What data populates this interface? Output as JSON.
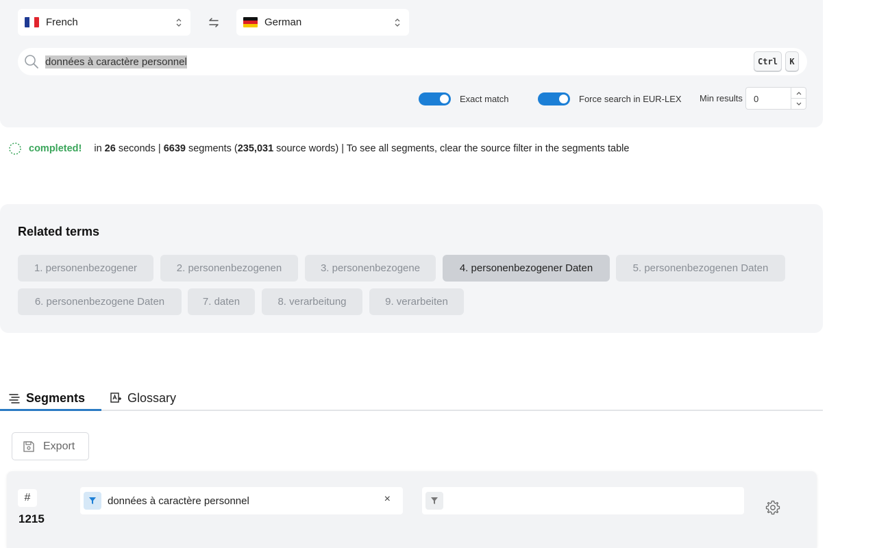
{
  "languages": {
    "source": "French",
    "target": "German",
    "swap_icon": "swap-arrows-icon"
  },
  "search": {
    "query": "données à caractère personnel",
    "shortcut_keys": [
      "Ctrl",
      "K"
    ]
  },
  "options": {
    "exact_match_label": "Exact match",
    "exact_match_on": true,
    "force_search_label": "Force search in EUR-LEX",
    "force_search_on": true,
    "min_results_label": "Min results",
    "min_results_value": "0"
  },
  "status": {
    "state": "completed!",
    "prefix": "in",
    "seconds": "26",
    "seconds_label": "seconds |",
    "segments": "6639",
    "segments_label": "segments (",
    "source_words": "235,031",
    "source_words_label": "source words) | To see all segments, clear the source filter in the segments table"
  },
  "related_terms": {
    "title": "Related terms",
    "items": [
      "1. personenbezogener",
      "2. personenbezogenen",
      "3. personenbezogene",
      "4. personenbezogener Daten",
      "5. personenbezogenen Daten",
      "6. personenbezogene Daten",
      "7. daten",
      "8. verarbeitung",
      "9. verarbeiten"
    ],
    "active_index": 3
  },
  "tabs": {
    "segments": "Segments",
    "glossary": "Glossary"
  },
  "toolbar": {
    "export_label": "Export"
  },
  "table": {
    "hash_symbol": "#",
    "row_count": "1215",
    "source_filter": "données à caractère personnel",
    "clear_symbol": "×",
    "target_filter": ""
  },
  "colors": {
    "accent": "#1c7fd6",
    "success": "#3aa55a",
    "panel_bg": "#f4f5f7"
  }
}
